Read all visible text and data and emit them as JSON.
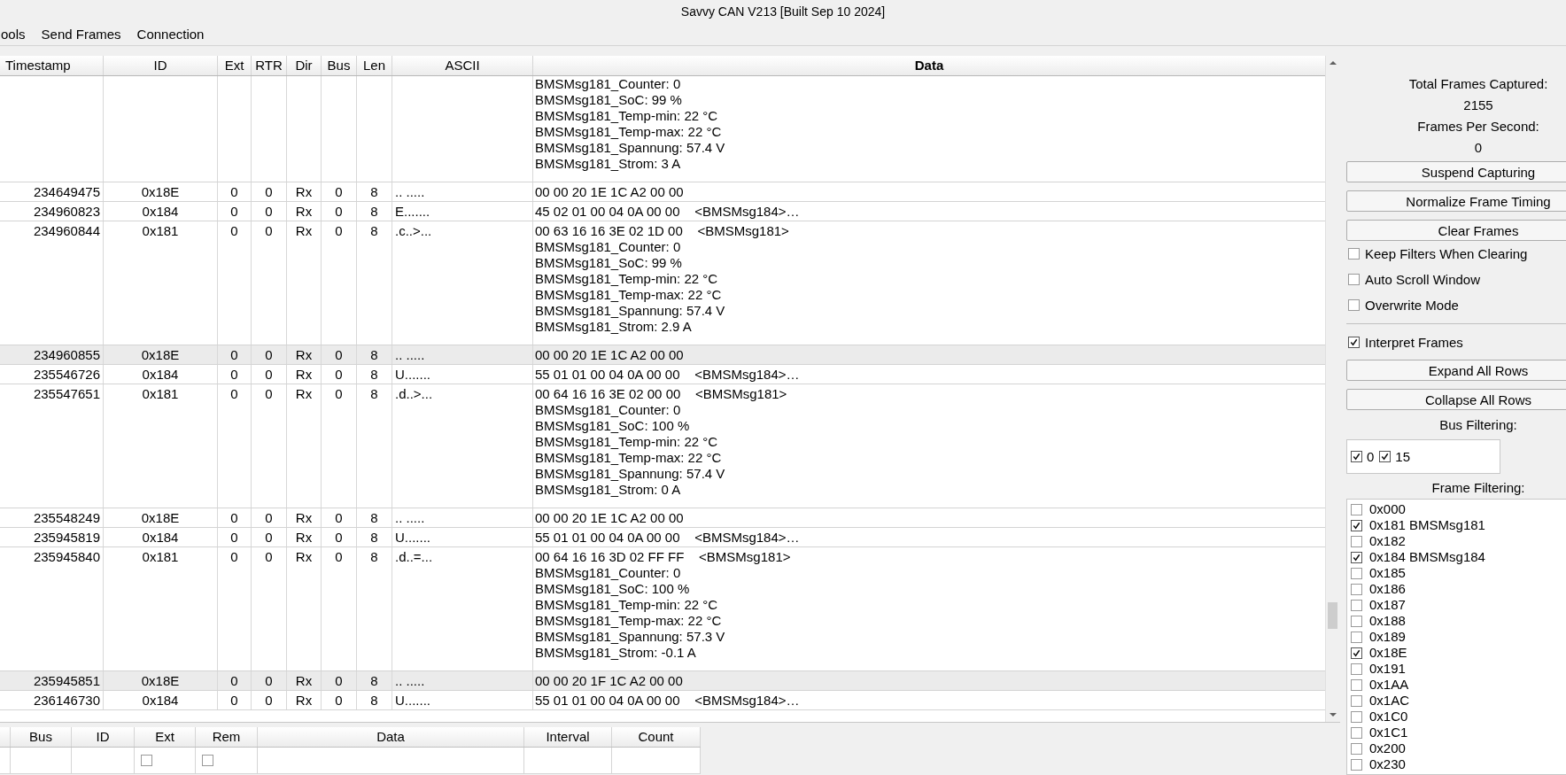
{
  "window": {
    "title": "Savvy CAN V213 [Built Sep 10 2024]"
  },
  "menu": [
    "ools",
    "Send Frames",
    "Connection"
  ],
  "frames_table": {
    "columns": [
      "Timestamp",
      "ID",
      "Ext",
      "RTR",
      "Dir",
      "Bus",
      "Len",
      "ASCII",
      "Data"
    ],
    "rows": [
      {
        "data": [
          "BMSMsg181_Counter: 0",
          "BMSMsg181_SoC: 99 %",
          "BMSMsg181_Temp-min: 22 °C",
          "BMSMsg181_Temp-max: 22 °C",
          "BMSMsg181_Spannung: 57.4 V",
          "BMSMsg181_Strom: 3 A"
        ],
        "shaded": false
      },
      {
        "timestamp": "234649475",
        "id": "0x18E",
        "ext": "0",
        "rtr": "0",
        "dir": "Rx",
        "bus": "0",
        "len": "8",
        "ascii": ".. .....",
        "data": [
          "00 00 20 1E 1C A2 00 00"
        ],
        "shaded": false
      },
      {
        "timestamp": "234960823",
        "id": "0x184",
        "ext": "0",
        "rtr": "0",
        "dir": "Rx",
        "bus": "0",
        "len": "8",
        "ascii": "E.......",
        "data": [
          "45 02 01 00 04 0A 00 00    <BMSMsg184>…"
        ],
        "shaded": false
      },
      {
        "timestamp": "234960844",
        "id": "0x181",
        "ext": "0",
        "rtr": "0",
        "dir": "Rx",
        "bus": "0",
        "len": "8",
        "ascii": ".c..>...",
        "data": [
          "00 63 16 16 3E 02 1D 00    <BMSMsg181>",
          "BMSMsg181_Counter: 0",
          "BMSMsg181_SoC: 99 %",
          "BMSMsg181_Temp-min: 22 °C",
          "BMSMsg181_Temp-max: 22 °C",
          "BMSMsg181_Spannung: 57.4 V",
          "BMSMsg181_Strom: 2.9 A"
        ],
        "shaded": false
      },
      {
        "timestamp": "234960855",
        "id": "0x18E",
        "ext": "0",
        "rtr": "0",
        "dir": "Rx",
        "bus": "0",
        "len": "8",
        "ascii": ".. .....",
        "data": [
          "00 00 20 1E 1C A2 00 00"
        ],
        "shaded": true
      },
      {
        "timestamp": "235546726",
        "id": "0x184",
        "ext": "0",
        "rtr": "0",
        "dir": "Rx",
        "bus": "0",
        "len": "8",
        "ascii": "U.......",
        "data": [
          "55 01 01 00 04 0A 00 00    <BMSMsg184>…"
        ],
        "shaded": false
      },
      {
        "timestamp": "235547651",
        "id": "0x181",
        "ext": "0",
        "rtr": "0",
        "dir": "Rx",
        "bus": "0",
        "len": "8",
        "ascii": ".d..>...",
        "data": [
          "00 64 16 16 3E 02 00 00    <BMSMsg181>",
          "BMSMsg181_Counter: 0",
          "BMSMsg181_SoC: 100 %",
          "BMSMsg181_Temp-min: 22 °C",
          "BMSMsg181_Temp-max: 22 °C",
          "BMSMsg181_Spannung: 57.4 V",
          "BMSMsg181_Strom: 0 A"
        ],
        "shaded": false
      },
      {
        "timestamp": "235548249",
        "id": "0x18E",
        "ext": "0",
        "rtr": "0",
        "dir": "Rx",
        "bus": "0",
        "len": "8",
        "ascii": ".. .....",
        "data": [
          "00 00 20 1E 1C A2 00 00"
        ],
        "shaded": false
      },
      {
        "timestamp": "235945819",
        "id": "0x184",
        "ext": "0",
        "rtr": "0",
        "dir": "Rx",
        "bus": "0",
        "len": "8",
        "ascii": "U.......",
        "data": [
          "55 01 01 00 04 0A 00 00    <BMSMsg184>…"
        ],
        "shaded": false
      },
      {
        "timestamp": "235945840",
        "id": "0x181",
        "ext": "0",
        "rtr": "0",
        "dir": "Rx",
        "bus": "0",
        "len": "8",
        "ascii": ".d..=...",
        "data": [
          "00 64 16 16 3D 02 FF FF    <BMSMsg181>",
          "BMSMsg181_Counter: 0",
          "BMSMsg181_SoC: 100 %",
          "BMSMsg181_Temp-min: 22 °C",
          "BMSMsg181_Temp-max: 22 °C",
          "BMSMsg181_Spannung: 57.3 V",
          "BMSMsg181_Strom: -0.1 A"
        ],
        "shaded": false
      },
      {
        "timestamp": "235945851",
        "id": "0x18E",
        "ext": "0",
        "rtr": "0",
        "dir": "Rx",
        "bus": "0",
        "len": "8",
        "ascii": ".. .....",
        "data": [
          "00 00 20 1F 1C A2 00 00"
        ],
        "shaded": true
      },
      {
        "timestamp": "236146730",
        "id": "0x184",
        "ext": "0",
        "rtr": "0",
        "dir": "Rx",
        "bus": "0",
        "len": "8",
        "ascii": "U.......",
        "data": [
          "55 01 01 00 04 0A 00 00    <BMSMsg184>…"
        ],
        "shaded": false
      }
    ]
  },
  "send_table": {
    "columns": [
      "Bus",
      "ID",
      "Ext",
      "Rem",
      "Data",
      "Interval",
      "Count"
    ],
    "rows": [
      {
        "ext": false,
        "rem": false
      }
    ]
  },
  "stats": [
    {
      "label": "Total Frames Captured:",
      "value": "2155"
    },
    {
      "label": "Frames Per Second:",
      "value": "0"
    }
  ],
  "capture_buttons": [
    "Suspend Capturing",
    "Normalize Frame Timing",
    "Clear Frames"
  ],
  "options": [
    {
      "label": "Keep Filters When Clearing",
      "checked": false
    },
    {
      "label": "Auto Scroll Window",
      "checked": false
    },
    {
      "label": "Overwrite Mode",
      "checked": false
    }
  ],
  "interpret": {
    "label": "Interpret Frames",
    "checked": true
  },
  "row_buttons": [
    "Expand All Rows",
    "Collapse All Rows"
  ],
  "bus_filtering": {
    "title": "Bus Filtering:",
    "buses": [
      {
        "label": "0",
        "checked": true
      },
      {
        "label": "15",
        "checked": true
      }
    ]
  },
  "frame_filtering": {
    "title": "Frame Filtering:",
    "items": [
      {
        "label": "0x000",
        "checked": false
      },
      {
        "label": "0x181 BMSMsg181",
        "checked": true
      },
      {
        "label": "0x182",
        "checked": false
      },
      {
        "label": "0x184 BMSMsg184",
        "checked": true
      },
      {
        "label": "0x185",
        "checked": false
      },
      {
        "label": "0x186",
        "checked": false
      },
      {
        "label": "0x187",
        "checked": false
      },
      {
        "label": "0x188",
        "checked": false
      },
      {
        "label": "0x189",
        "checked": false
      },
      {
        "label": "0x18E",
        "checked": true
      },
      {
        "label": "0x191",
        "checked": false
      },
      {
        "label": "0x1AA",
        "checked": false
      },
      {
        "label": "0x1AC",
        "checked": false
      },
      {
        "label": "0x1C0",
        "checked": false
      },
      {
        "label": "0x1C1",
        "checked": false
      },
      {
        "label": "0x200",
        "checked": false
      },
      {
        "label": "0x230",
        "checked": false
      }
    ]
  }
}
